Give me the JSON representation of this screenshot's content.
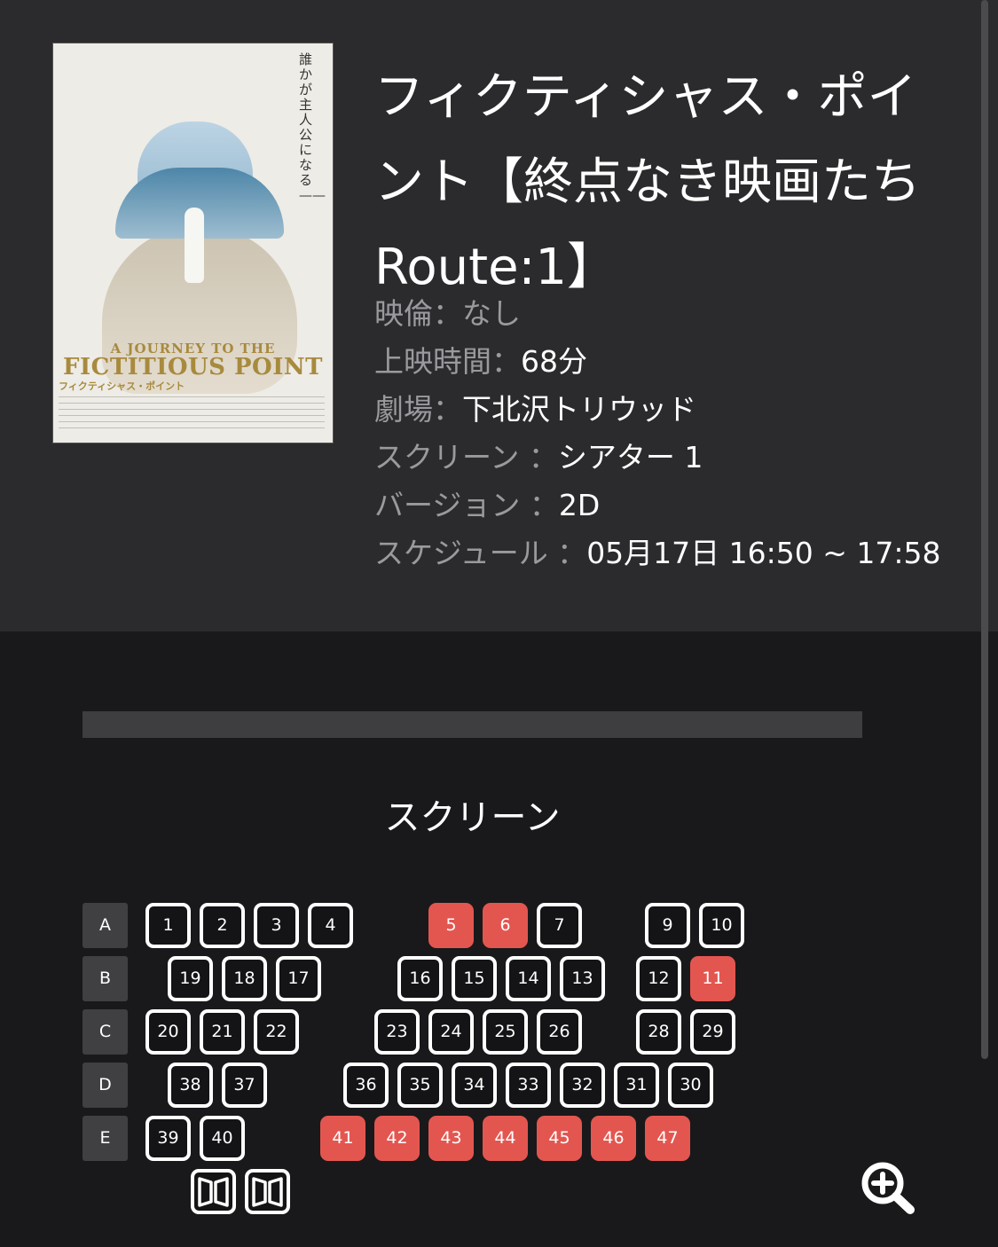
{
  "movie": {
    "title": "フィクティシャス・ポイント【終点なき映画たち Route:1】",
    "poster": {
      "tagline": "誰かが主人公になる——",
      "title_en_small": "A JOURNEY TO THE",
      "title_en_large": "FICTITIOUS POINT",
      "title_jp": "フィクティシャス・ポイント"
    },
    "info": [
      {
        "label": "映倫：",
        "value": "なし"
      },
      {
        "label": "上映時間：",
        "value": "68分"
      },
      {
        "label": "劇場：",
        "value": "下北沢トリウッド"
      },
      {
        "label": "スクリーン ：",
        "value": "シアター 1"
      },
      {
        "label": "バージョン ：",
        "value": "2D"
      },
      {
        "label": "スケジュール ：",
        "value": "05月17日 16:50 ~ 17:58"
      }
    ]
  },
  "seatmap": {
    "screen_label": "スクリーン",
    "rows": [
      "A",
      "B",
      "C",
      "D",
      "E"
    ],
    "seats": [
      {
        "row": "A",
        "num": "1",
        "sold": false
      },
      {
        "row": "A",
        "num": "2",
        "sold": false
      },
      {
        "row": "A",
        "num": "3",
        "sold": false
      },
      {
        "row": "A",
        "num": "4",
        "sold": false
      },
      {
        "row": "A",
        "num": "5",
        "sold": true
      },
      {
        "row": "A",
        "num": "6",
        "sold": true
      },
      {
        "row": "A",
        "num": "7",
        "sold": false
      },
      {
        "row": "A",
        "num": "9",
        "sold": false
      },
      {
        "row": "A",
        "num": "10",
        "sold": false
      },
      {
        "row": "B",
        "num": "19",
        "sold": false
      },
      {
        "row": "B",
        "num": "18",
        "sold": false
      },
      {
        "row": "B",
        "num": "17",
        "sold": false
      },
      {
        "row": "B",
        "num": "16",
        "sold": false
      },
      {
        "row": "B",
        "num": "15",
        "sold": false
      },
      {
        "row": "B",
        "num": "14",
        "sold": false
      },
      {
        "row": "B",
        "num": "13",
        "sold": false
      },
      {
        "row": "B",
        "num": "12",
        "sold": false
      },
      {
        "row": "B",
        "num": "11",
        "sold": true
      },
      {
        "row": "C",
        "num": "20",
        "sold": false
      },
      {
        "row": "C",
        "num": "21",
        "sold": false
      },
      {
        "row": "C",
        "num": "22",
        "sold": false
      },
      {
        "row": "C",
        "num": "23",
        "sold": false
      },
      {
        "row": "C",
        "num": "24",
        "sold": false
      },
      {
        "row": "C",
        "num": "25",
        "sold": false
      },
      {
        "row": "C",
        "num": "26",
        "sold": false
      },
      {
        "row": "C",
        "num": "28",
        "sold": false
      },
      {
        "row": "C",
        "num": "29",
        "sold": false
      },
      {
        "row": "D",
        "num": "38",
        "sold": false
      },
      {
        "row": "D",
        "num": "37",
        "sold": false
      },
      {
        "row": "D",
        "num": "36",
        "sold": false
      },
      {
        "row": "D",
        "num": "35",
        "sold": false
      },
      {
        "row": "D",
        "num": "34",
        "sold": false
      },
      {
        "row": "D",
        "num": "33",
        "sold": false
      },
      {
        "row": "D",
        "num": "32",
        "sold": false
      },
      {
        "row": "D",
        "num": "31",
        "sold": false
      },
      {
        "row": "D",
        "num": "30",
        "sold": false
      },
      {
        "row": "E",
        "num": "39",
        "sold": false
      },
      {
        "row": "E",
        "num": "40",
        "sold": false
      },
      {
        "row": "E",
        "num": "41",
        "sold": true
      },
      {
        "row": "E",
        "num": "42",
        "sold": true
      },
      {
        "row": "E",
        "num": "43",
        "sold": true
      },
      {
        "row": "E",
        "num": "44",
        "sold": true
      },
      {
        "row": "E",
        "num": "45",
        "sold": true
      },
      {
        "row": "E",
        "num": "46",
        "sold": true
      },
      {
        "row": "E",
        "num": "47",
        "sold": true
      }
    ],
    "doors": [
      "door-icon",
      "door-icon"
    ]
  },
  "colors": {
    "header_bg": "#2b2b2d",
    "page_bg": "#19191b",
    "sold_seat": "#e35650",
    "seat_border": "#ffffff",
    "label_gray": "#9a9a9e"
  },
  "icons": [
    "zoom-in-icon",
    "door-icon"
  ]
}
